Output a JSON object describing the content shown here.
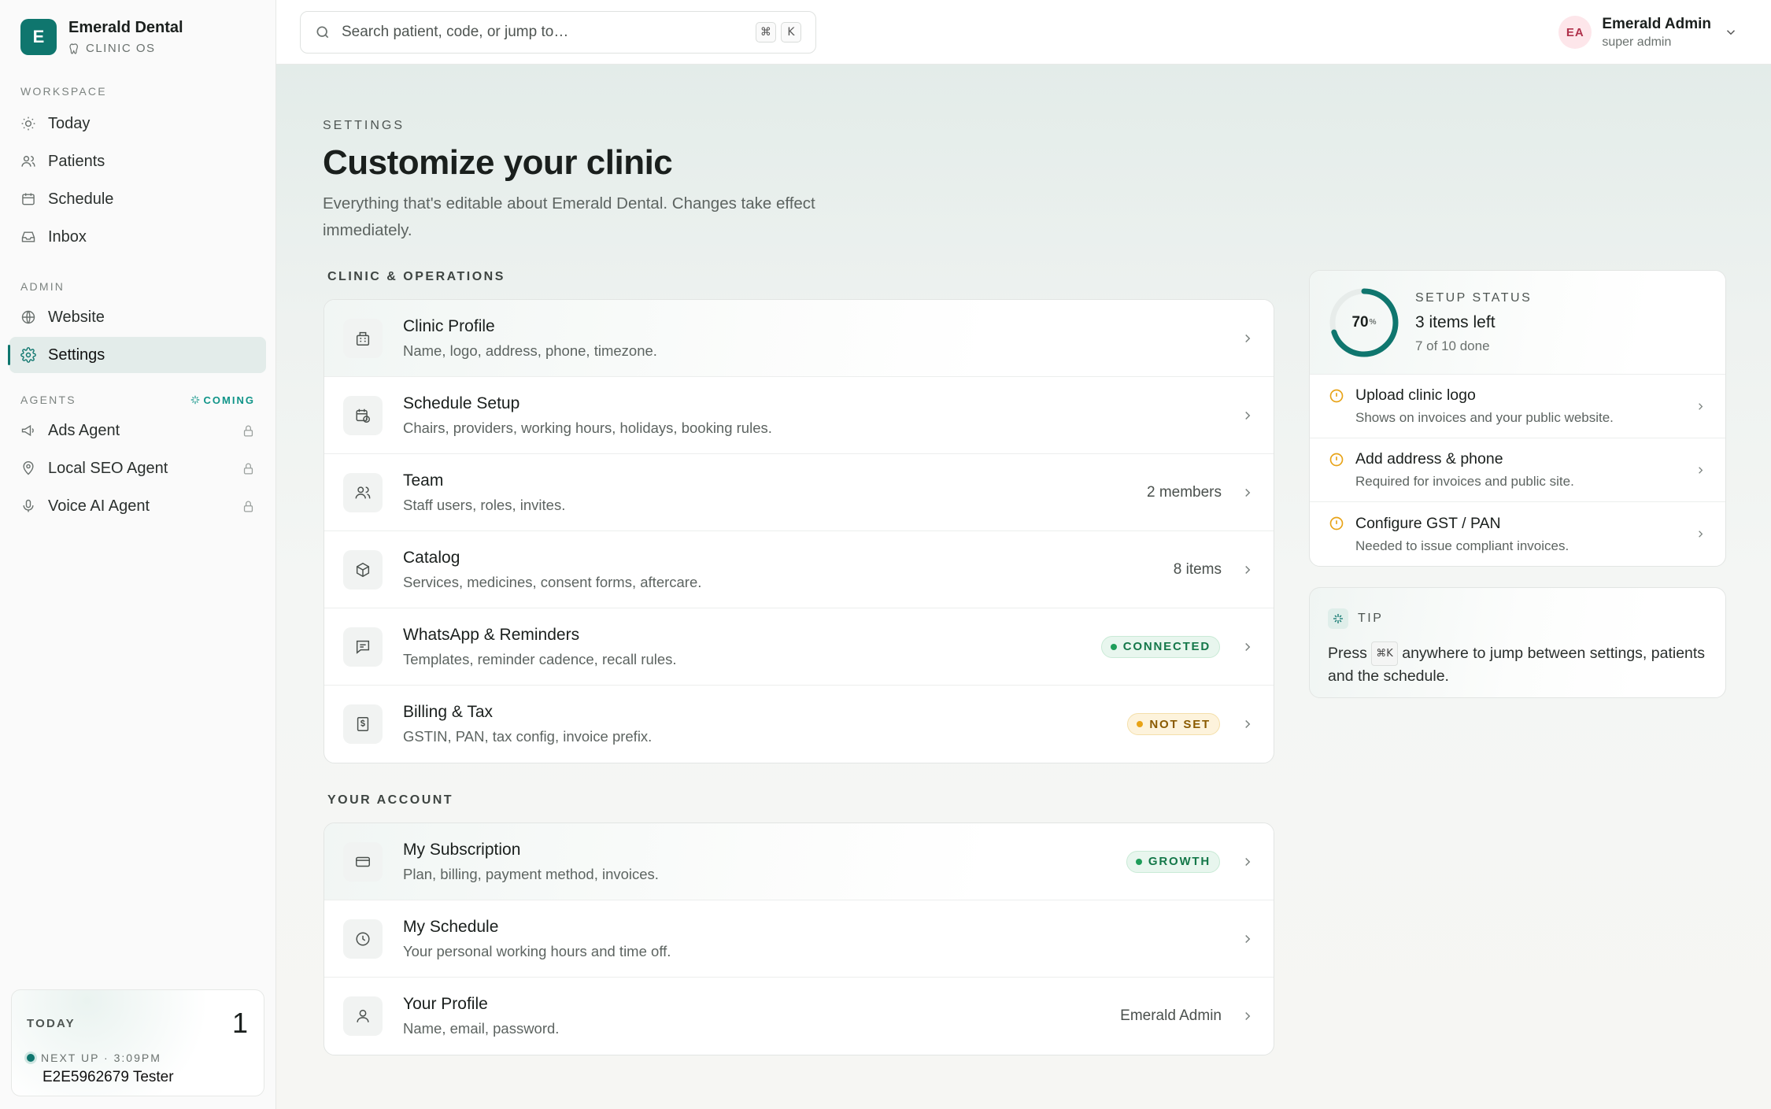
{
  "brand": {
    "initial": "E",
    "name": "Emerald Dental",
    "subtitle": "CLINIC OS"
  },
  "sidebar": {
    "workspace_label": "WORKSPACE",
    "workspace_items": [
      {
        "label": "Today",
        "icon": "sun-icon"
      },
      {
        "label": "Patients",
        "icon": "users-icon"
      },
      {
        "label": "Schedule",
        "icon": "calendar-icon"
      },
      {
        "label": "Inbox",
        "icon": "inbox-icon"
      }
    ],
    "admin_label": "ADMIN",
    "admin_items": [
      {
        "label": "Website",
        "icon": "globe-icon"
      },
      {
        "label": "Settings",
        "icon": "gear-icon",
        "active": true
      }
    ],
    "agents_label": "AGENTS",
    "agents_badge": "COMING",
    "agent_items": [
      {
        "label": "Ads Agent",
        "icon": "megaphone-icon",
        "locked": true
      },
      {
        "label": "Local SEO Agent",
        "icon": "map-pin-icon",
        "locked": true
      },
      {
        "label": "Voice AI Agent",
        "icon": "microphone-icon",
        "locked": true
      }
    ],
    "today_card": {
      "label": "TODAY",
      "count": "1",
      "next_up": "NEXT UP · 3:09PM",
      "patient": "E2E5962679 Tester"
    }
  },
  "topbar": {
    "search_placeholder": "Search patient, code, or jump to…",
    "shortcut_keys": [
      "⌘",
      "K"
    ],
    "user": {
      "initials": "EA",
      "name": "Emerald Admin",
      "role": "super admin"
    }
  },
  "page": {
    "eyebrow": "SETTINGS",
    "title": "Customize your clinic",
    "description": "Everything that's editable about Emerald Dental. Changes take effect immediately."
  },
  "clinic_section": {
    "label": "CLINIC & OPERATIONS",
    "rows": [
      {
        "title": "Clinic Profile",
        "subtitle": "Name, logo, address, phone, timezone.",
        "icon": "building-icon"
      },
      {
        "title": "Schedule Setup",
        "subtitle": "Chairs, providers, working hours, holidays, booking rules.",
        "icon": "calendar-clock-icon"
      },
      {
        "title": "Team",
        "subtitle": "Staff users, roles, invites.",
        "icon": "users-icon",
        "meta": "2 members"
      },
      {
        "title": "Catalog",
        "subtitle": "Services, medicines, consent forms, aftercare.",
        "icon": "box-icon",
        "meta": "8 items"
      },
      {
        "title": "WhatsApp & Reminders",
        "subtitle": "Templates, reminder cadence, recall rules.",
        "icon": "message-icon",
        "badge": "CONNECTED"
      },
      {
        "title": "Billing & Tax",
        "subtitle": "GSTIN, PAN, tax config, invoice prefix.",
        "icon": "receipt-icon",
        "badge": "NOT SET"
      }
    ]
  },
  "account_section": {
    "label": "YOUR ACCOUNT",
    "rows": [
      {
        "title": "My Subscription",
        "subtitle": "Plan, billing, payment method, invoices.",
        "icon": "credit-card-icon",
        "badge": "GROWTH"
      },
      {
        "title": "My Schedule",
        "subtitle": "Your personal working hours and time off.",
        "icon": "clock-icon"
      },
      {
        "title": "Your Profile",
        "subtitle": "Name, email, password.",
        "icon": "user-icon",
        "meta": "Emerald Admin"
      }
    ]
  },
  "setup_status": {
    "label": "SETUP STATUS",
    "percent": 70,
    "percent_text": "70",
    "percent_unit": "%",
    "headline": "3 items left",
    "progress": "7 of 10 done",
    "tasks": [
      {
        "title": "Upload clinic logo",
        "subtitle": "Shows on invoices and your public website."
      },
      {
        "title": "Add address & phone",
        "subtitle": "Required for invoices and public site."
      },
      {
        "title": "Configure GST / PAN",
        "subtitle": "Needed to issue compliant invoices."
      }
    ]
  },
  "tip": {
    "label": "TIP",
    "prefix": "Press",
    "shortcut": "⌘K",
    "suffix": "anywhere to jump between settings, patients and the schedule."
  },
  "colors": {
    "accent": "#0f766e",
    "connected": "#1f9d5a",
    "warning": "#e8a317",
    "avatar_bg": "#fde6ea"
  }
}
